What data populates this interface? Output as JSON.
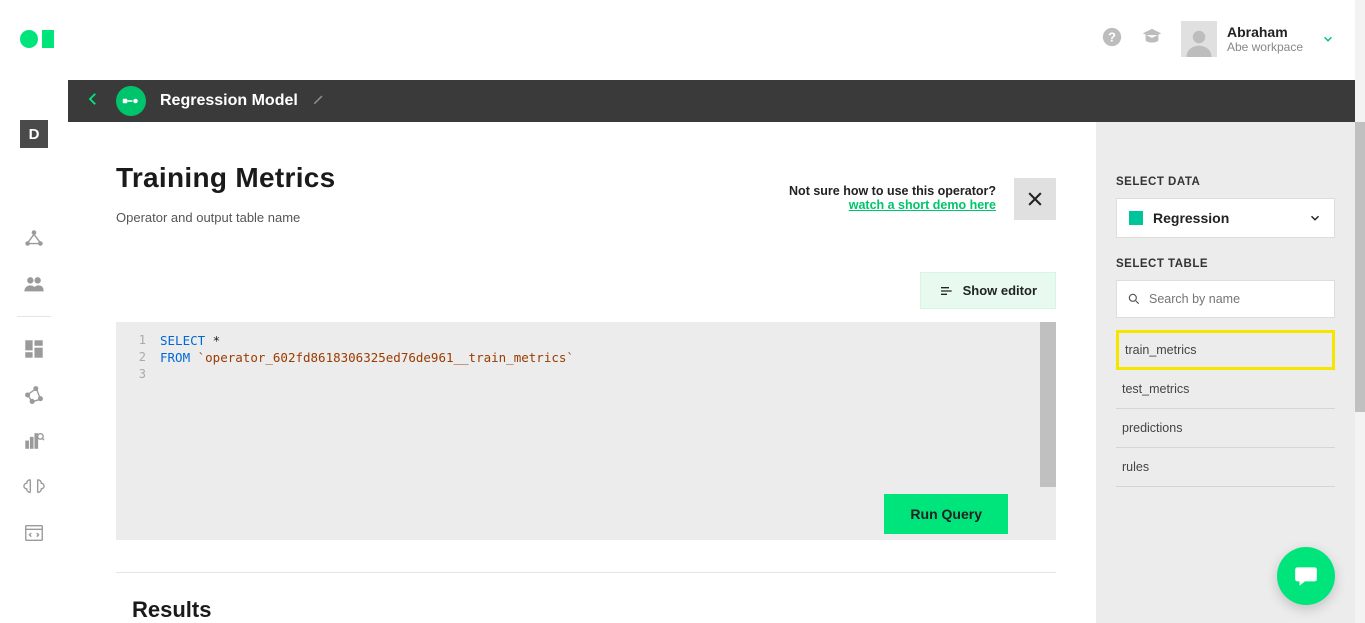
{
  "header": {
    "user_name": "Abraham",
    "workspace": "Abe workpace"
  },
  "leftnav": {
    "tile": "D"
  },
  "titlestrip": {
    "title": "Regression Model"
  },
  "page": {
    "title": "Training Metrics",
    "subtitle": "Operator and output table name",
    "help_question": "Not sure how to use this operator?",
    "help_link": "watch a short demo here",
    "show_editor": "Show editor",
    "run_query": "Run Query",
    "results": "Results"
  },
  "editor": {
    "lines": [
      "1",
      "2",
      "3"
    ],
    "kw_select": "SELECT",
    "star": " *",
    "kw_from": "FROM",
    "table": " `operator_602fd8618306325ed76de961__train_metrics`"
  },
  "sidebar": {
    "select_data_label": "SELECT DATA",
    "select_data_value": "Regression",
    "select_table_label": "SELECT TABLE",
    "search_placeholder": "Search by name",
    "tables": {
      "0": "train_metrics",
      "1": "test_metrics",
      "2": "predictions",
      "3": "rules"
    }
  }
}
